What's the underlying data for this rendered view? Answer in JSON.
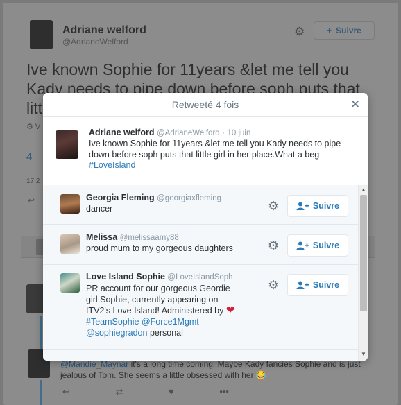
{
  "background": {
    "author_name": "Adriane welford",
    "author_handle": "@AdrianeWelford",
    "follow_label": "Suivre",
    "tweet_text": "Ive known Sophie for 11years &let me tell you Kady needs to pipe down before soph puts that little girl in her place.",
    "reply": {
      "mention": "@Mandie_Maynar",
      "text": " it's a long time coming. Maybe Kady fancies Sophie and is just jealous of Tom. She seems a little obsessed with her 😂"
    }
  },
  "modal": {
    "title": "Retweeté 4 fois",
    "close_icon": "close-icon",
    "original": {
      "name": "Adriane welford",
      "handle": "@AdrianeWelford",
      "separator": "·",
      "date": "10 juin",
      "text": "Ive known Sophie for 11years &let me tell you Kady needs to pipe down before soph puts that little girl in her place.What a beg",
      "hashtag": "#LoveIsland"
    },
    "users": [
      {
        "name": "Georgia Fleming",
        "handle": "@georgiaxfleming",
        "bio": "dancer",
        "follow_label": "Suivre"
      },
      {
        "name": "Melissa",
        "handle": "@melissaamy88",
        "bio": "proud mum to my gorgeous daughters",
        "follow_label": "Suivre"
      },
      {
        "name": "Love Island Sophie",
        "handle": "@LoveIslandSoph",
        "bio_text": "PR account for our gorgeous Geordie girl Sophie, currently appearing on ITV2's Love Island! Administered by",
        "bio_heart": "❤",
        "bio_link1": "#TeamSophie",
        "bio_link2": "@Force1Mgmt",
        "bio_link3": "@sophiegradon",
        "bio_tail": "personal",
        "follow_label": "Suivre"
      }
    ]
  },
  "colors": {
    "link": "#2b7bb9",
    "overlay": "#7a7a7a",
    "heart": "#d31e36"
  }
}
